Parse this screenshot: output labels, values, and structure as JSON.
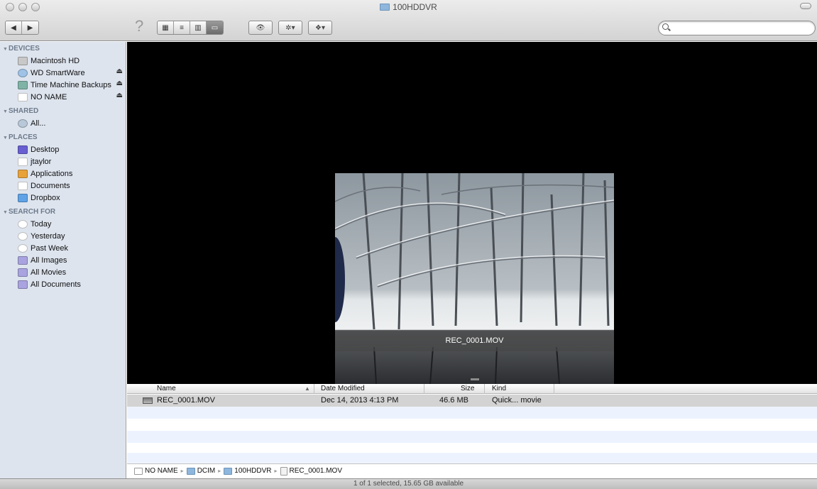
{
  "window": {
    "title": "100HDDVR"
  },
  "toolbar": {
    "back_label": "◀",
    "forward_label": "▶",
    "help_label": "?",
    "view_icons": "▦",
    "view_list": "≡",
    "view_columns": "▥",
    "view_coverflow": "▭",
    "quicklook_label": "👁",
    "action_label": "✲▾",
    "dropbox_label": "❖▾",
    "search_placeholder": "",
    "search_value": ""
  },
  "sidebar": {
    "sections": [
      {
        "title": "DEVICES",
        "items": [
          {
            "label": "Macintosh HD",
            "icon": "harddisk-icon",
            "eject": false
          },
          {
            "label": "WD SmartWare",
            "icon": "disc-icon",
            "eject": true
          },
          {
            "label": "Time Machine Backups",
            "icon": "timemachine-icon",
            "eject": true
          },
          {
            "label": "NO NAME",
            "icon": "drive-icon",
            "eject": true
          }
        ]
      },
      {
        "title": "SHARED",
        "items": [
          {
            "label": "All...",
            "icon": "network-icon"
          }
        ]
      },
      {
        "title": "PLACES",
        "items": [
          {
            "label": "Desktop",
            "icon": "desktop-icon"
          },
          {
            "label": "jtaylor",
            "icon": "home-icon"
          },
          {
            "label": "Applications",
            "icon": "applications-icon"
          },
          {
            "label": "Documents",
            "icon": "documents-icon"
          },
          {
            "label": "Dropbox",
            "icon": "dropbox-icon"
          }
        ]
      },
      {
        "title": "SEARCH FOR",
        "items": [
          {
            "label": "Today",
            "icon": "clock-icon"
          },
          {
            "label": "Yesterday",
            "icon": "clock-icon"
          },
          {
            "label": "Past Week",
            "icon": "clock-icon"
          },
          {
            "label": "All Images",
            "icon": "smart-folder-icon"
          },
          {
            "label": "All Movies",
            "icon": "smart-folder-icon"
          },
          {
            "label": "All Documents",
            "icon": "smart-folder-icon"
          }
        ]
      }
    ],
    "eject_glyph": "⏏"
  },
  "preview": {
    "caption": "REC_0001.MOV"
  },
  "list": {
    "columns": [
      "Name",
      "Date Modified",
      "Size",
      "Kind"
    ],
    "sort_glyph": "▲",
    "rows": [
      {
        "name": "REC_0001.MOV",
        "date": "Dec 14, 2013 4:13 PM",
        "size": "46.6 MB",
        "kind": "Quick... movie"
      }
    ]
  },
  "pathbar": {
    "crumbs": [
      "NO NAME",
      "DCIM",
      "100HDDVR",
      "REC_0001.MOV"
    ],
    "sep": "▸"
  },
  "status": {
    "text": "1 of 1 selected, 15.65 GB available"
  },
  "colors": {
    "sidebar_bg": "#dde4ee",
    "selection_row": "#d3d3d3",
    "alt_row": "#edf3fe"
  }
}
